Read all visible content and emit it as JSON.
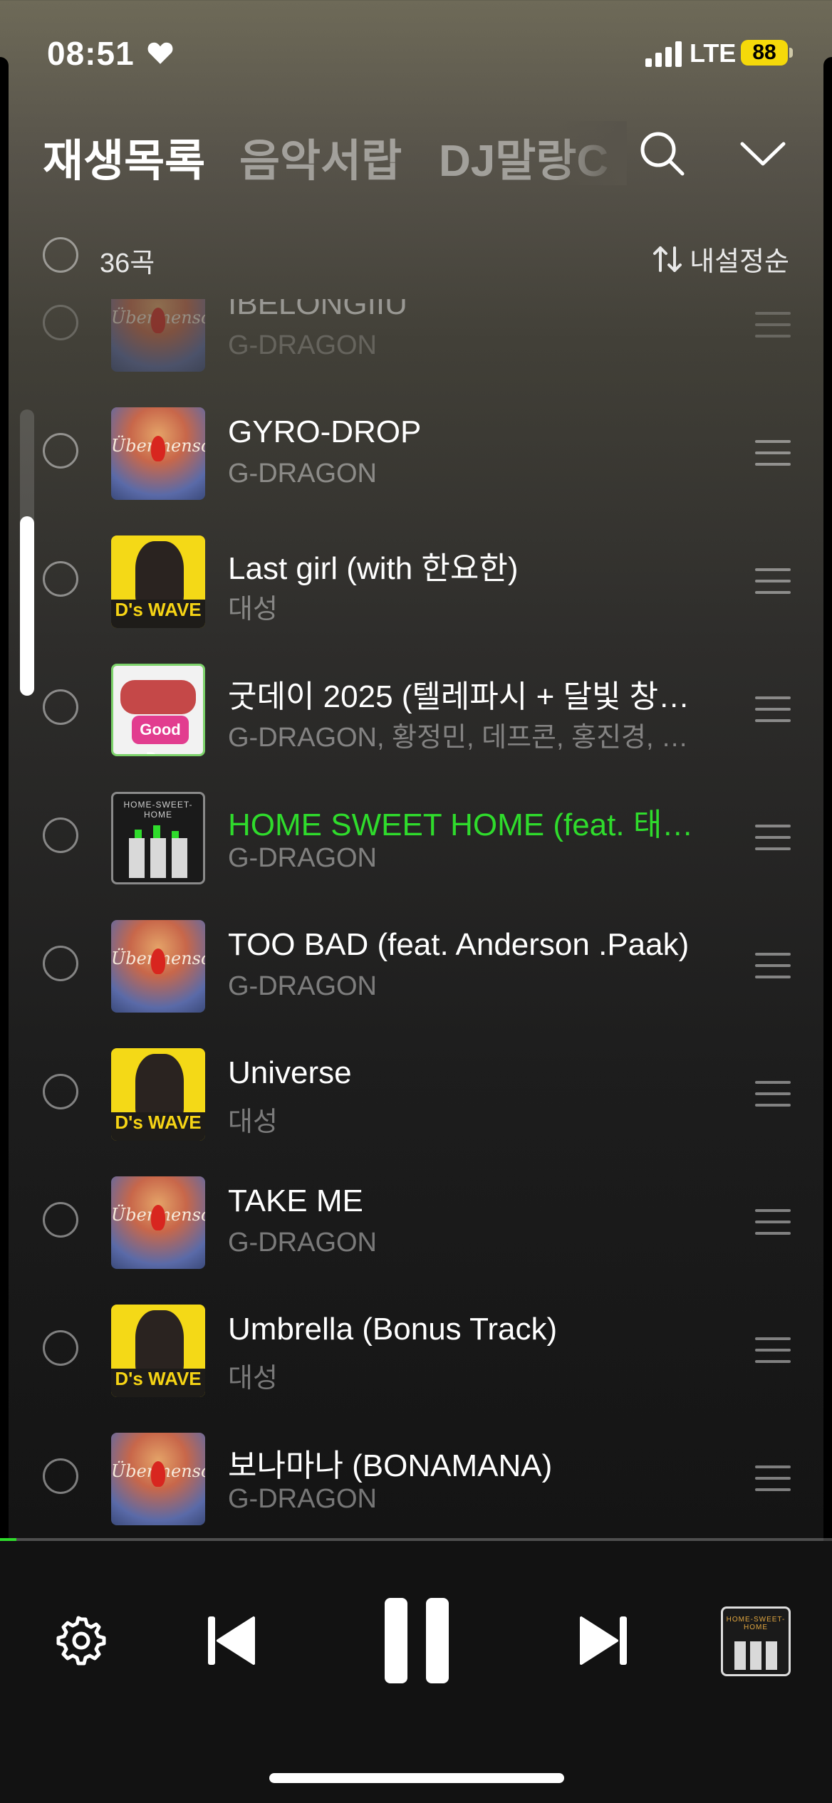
{
  "status_bar": {
    "time": "08:51",
    "network": "LTE",
    "battery": "88"
  },
  "tabs": [
    {
      "label": "재생목록",
      "active": true
    },
    {
      "label": "음악서랍",
      "active": false
    },
    {
      "label": "DJ말랑C",
      "active": false
    }
  ],
  "list_header": {
    "count": "36곡",
    "sort_label": "내설정순"
  },
  "tracks": [
    {
      "title": "IBELONGIIU",
      "artist": "G-DRAGON",
      "art": "ubermensch"
    },
    {
      "title": "GYRO-DROP",
      "artist": "G-DRAGON",
      "art": "ubermensch"
    },
    {
      "title": "Last girl (with 한요한)",
      "artist": "대성",
      "art": "ds-wave"
    },
    {
      "title": "굿데이 2025 (텔레파시 + 달빛 창…",
      "artist": "G-DRAGON, 황정민, 데프콘, 홍진경, 정…",
      "art": "good-day"
    },
    {
      "title": "HOME SWEET HOME (feat. 태…",
      "artist": "G-DRAGON",
      "art": "home-sweet-home",
      "playing": true
    },
    {
      "title": "TOO BAD (feat. Anderson .Paak)",
      "artist": "G-DRAGON",
      "art": "ubermensch"
    },
    {
      "title": "Universe",
      "artist": "대성",
      "art": "ds-wave"
    },
    {
      "title": "TAKE ME",
      "artist": "G-DRAGON",
      "art": "ubermensch"
    },
    {
      "title": "Umbrella (Bonus Track)",
      "artist": "대성",
      "art": "ds-wave"
    },
    {
      "title": "보나마나 (BONAMANA)",
      "artist": "G-DRAGON",
      "art": "ubermensch"
    }
  ],
  "album_art_text": {
    "ubermensch": "Übermensch",
    "ds_wave": "D's WAVE",
    "good_day": "Good Day",
    "home_sweet_home": "HOME-SWEET-HOME"
  },
  "player": {
    "progress_fraction": 0.02,
    "accent_color": "#2fdc2c",
    "icons": [
      "settings-icon",
      "previous-icon",
      "pause-icon",
      "next-icon",
      "now-playing-album-art"
    ]
  }
}
